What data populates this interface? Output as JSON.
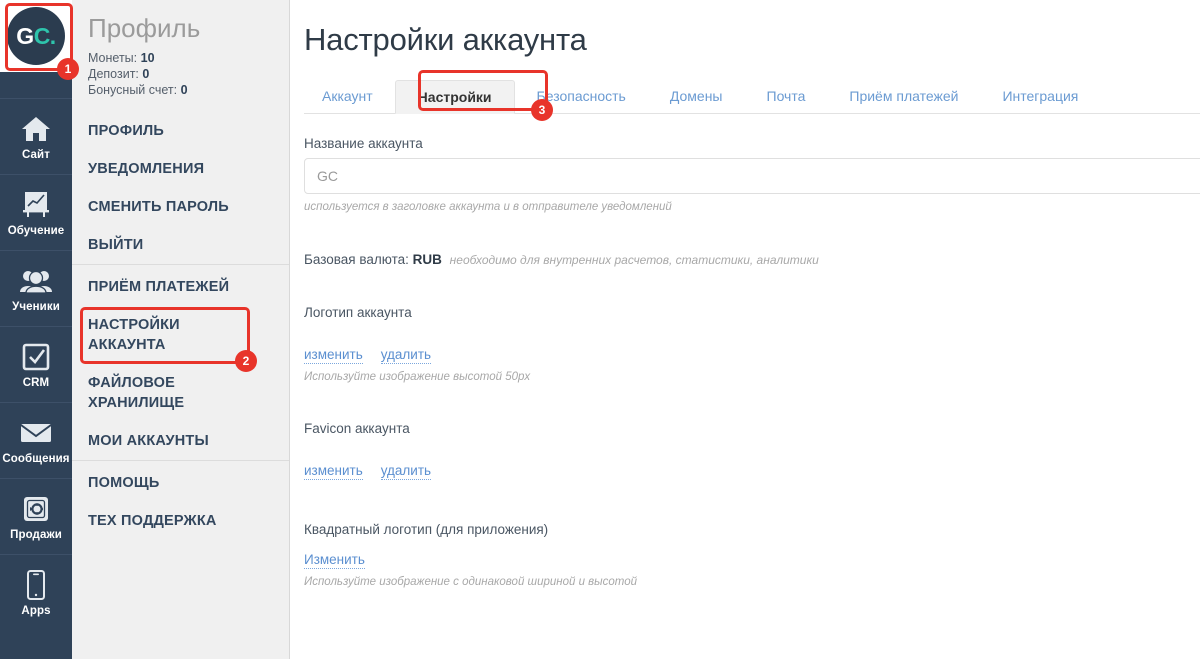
{
  "rail": {
    "logo": {
      "part1": "G",
      "part2": "C."
    },
    "items": [
      {
        "label": "Сайт",
        "icon": "home-icon"
      },
      {
        "label": "Обучение",
        "icon": "chart-board-icon"
      },
      {
        "label": "Ученики",
        "icon": "users-icon"
      },
      {
        "label": "CRM",
        "icon": "checkbox-icon"
      },
      {
        "label": "Сообщения",
        "icon": "envelope-icon"
      },
      {
        "label": "Продажи",
        "icon": "safe-icon"
      },
      {
        "label": "Apps",
        "icon": "mobile-icon"
      }
    ]
  },
  "profile": {
    "title": "Профиль",
    "stats": [
      {
        "label": "Монеты:",
        "value": "10"
      },
      {
        "label": "Депозит:",
        "value": "0"
      },
      {
        "label": "Бонусный счет:",
        "value": "0"
      }
    ],
    "menu": [
      {
        "label": "ПРОФИЛЬ",
        "divider": false
      },
      {
        "label": "УВЕДОМЛЕНИЯ",
        "divider": false
      },
      {
        "label": "СМЕНИТЬ ПАРОЛЬ",
        "divider": false
      },
      {
        "label": "ВЫЙТИ",
        "divider": false
      },
      {
        "label": "ПРИЁМ ПЛАТЕЖЕЙ",
        "divider": true
      },
      {
        "label": "НАСТРОЙКИ АККАУНТА",
        "divider": false
      },
      {
        "label": "ФАЙЛОВОЕ ХРАНИЛИЩЕ",
        "divider": false
      },
      {
        "label": "МОИ АККАУНТЫ",
        "divider": false
      },
      {
        "label": "ПОМОЩЬ",
        "divider": true
      },
      {
        "label": "ТЕХ ПОДДЕРЖКА",
        "divider": false
      }
    ]
  },
  "main": {
    "page_title": "Настройки аккаунта",
    "tabs": [
      {
        "label": "Аккаунт",
        "active": false
      },
      {
        "label": "Настройки",
        "active": true
      },
      {
        "label": "Безопасность",
        "active": false
      },
      {
        "label": "Домены",
        "active": false
      },
      {
        "label": "Почта",
        "active": false
      },
      {
        "label": "Приём платежей",
        "active": false
      },
      {
        "label": "Интеграция",
        "active": false
      }
    ],
    "account_name": {
      "label": "Название аккаунта",
      "value": "GC",
      "hint": "используется в заголовке аккаунта и в отправителе уведомлений"
    },
    "currency": {
      "label": "Базовая валюта:",
      "value": "RUB",
      "note": "необходимо для внутренних расчетов, статистики, аналитики"
    },
    "logo_block": {
      "label": "Логотип аккаунта",
      "change": "изменить",
      "delete": "удалить",
      "hint": "Используйте изображение высотой 50px"
    },
    "favicon_block": {
      "label": "Favicon аккаунта",
      "change": "изменить",
      "delete": "удалить"
    },
    "square_logo_block": {
      "label": "Квадратный логотип (для приложения)",
      "change": "Изменить",
      "hint": "Используйте изображение с одинаковой шириной и высотой"
    }
  },
  "annotations": {
    "marker1": "1",
    "marker2": "2",
    "marker3": "3"
  },
  "colors": {
    "rail_bg": "#2f4258",
    "panel_bg": "#f0f0f0",
    "accent_marker": "#e8342a",
    "link_blue": "#5b8fd0",
    "tab_blue": "#6b9bd2",
    "logo_teal": "#2ec4ac"
  }
}
